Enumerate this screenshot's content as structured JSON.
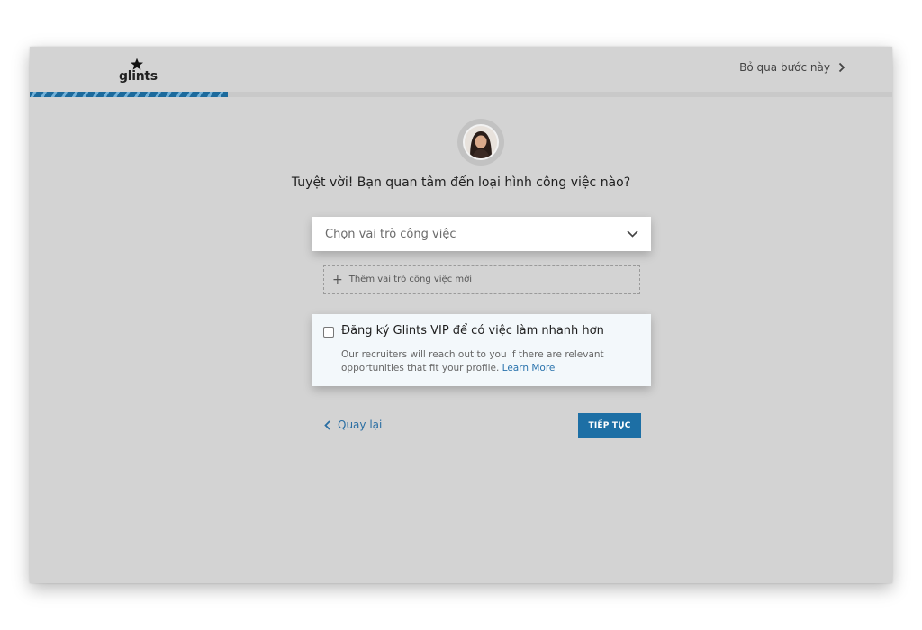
{
  "header": {
    "logo_text": "glints",
    "skip_label": "Bỏ qua bước này"
  },
  "progress": {
    "fraction": 0.23
  },
  "main": {
    "question": "Tuyệt vời! Bạn quan tâm đến loại hình công việc nào?",
    "role_select": {
      "placeholder": "Chọn vai trò công việc"
    },
    "add_role_label": "Thêm vai trò công việc mới",
    "vip": {
      "title": "Đăng ký Glints VIP để có việc làm nhanh hơn",
      "description": "Our recruiters will reach out to you if there are relevant opportunities that fit your profile.",
      "link_label": "Learn More",
      "checked": false
    },
    "back_label": "Quay lại",
    "continue_label": "TIẾP TỤC"
  },
  "colors": {
    "accent": "#1d6fa5",
    "link": "#2a73ad",
    "progress_stripe_dark": "#1c6a9c",
    "progress_stripe_light": "#73b1d8",
    "page_background": "#d3d3d3",
    "vip_card_background": "#f3f8fb"
  },
  "icons": {
    "logo": "star-icon",
    "skip": "chevron-right-icon",
    "select": "chevron-down-icon",
    "add": "plus-icon",
    "back": "chevron-left-icon"
  }
}
